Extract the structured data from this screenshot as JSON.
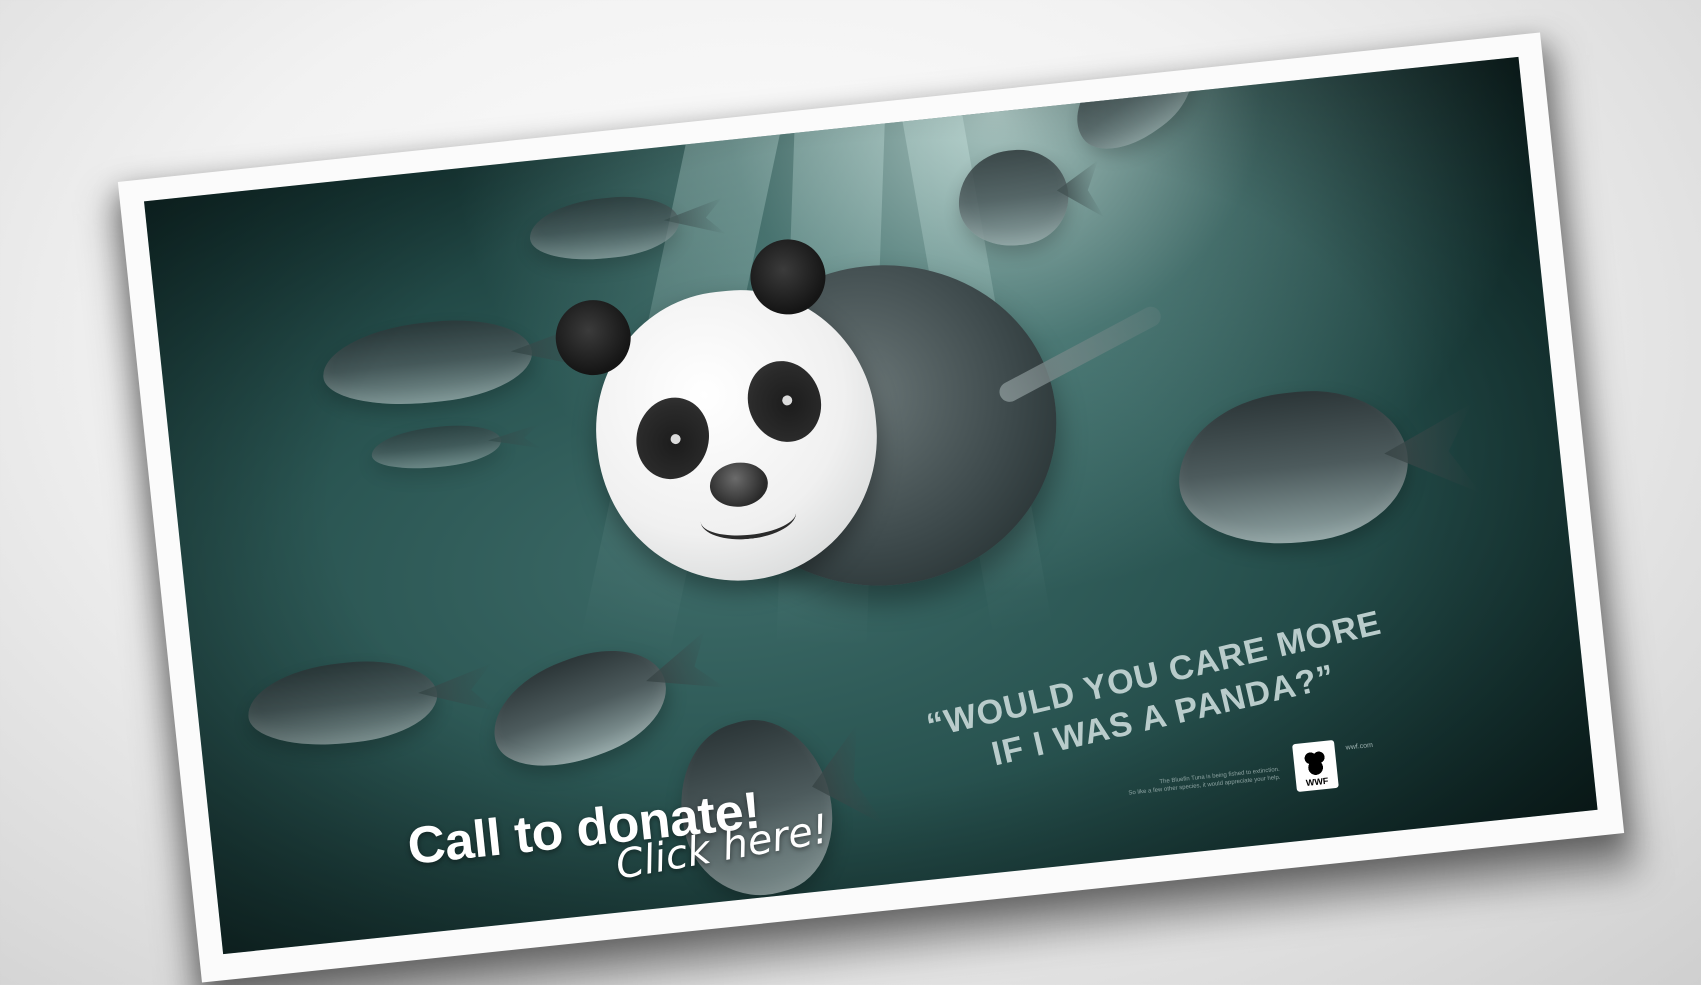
{
  "poster": {
    "headline_line1": "“WOULD YOU CARE MORE",
    "headline_line2": "IF I WAS A PANDA?”",
    "fine_print_line1": "The Bluefin Tuna is being fished to extinction.",
    "fine_print_line2": "So like a few other species, it would appreciate your help.",
    "logo_text": "WWF",
    "url": "wwf.com"
  },
  "cta": {
    "donate_label": "Call to donate!",
    "click_label": "Click here!"
  },
  "colors": {
    "background": "#e8e8e8",
    "water": "#2a5552",
    "headline": "#b9cccb",
    "cta_text": "#ffffff"
  },
  "icons": {
    "logo": "wwf-panda-logo"
  }
}
